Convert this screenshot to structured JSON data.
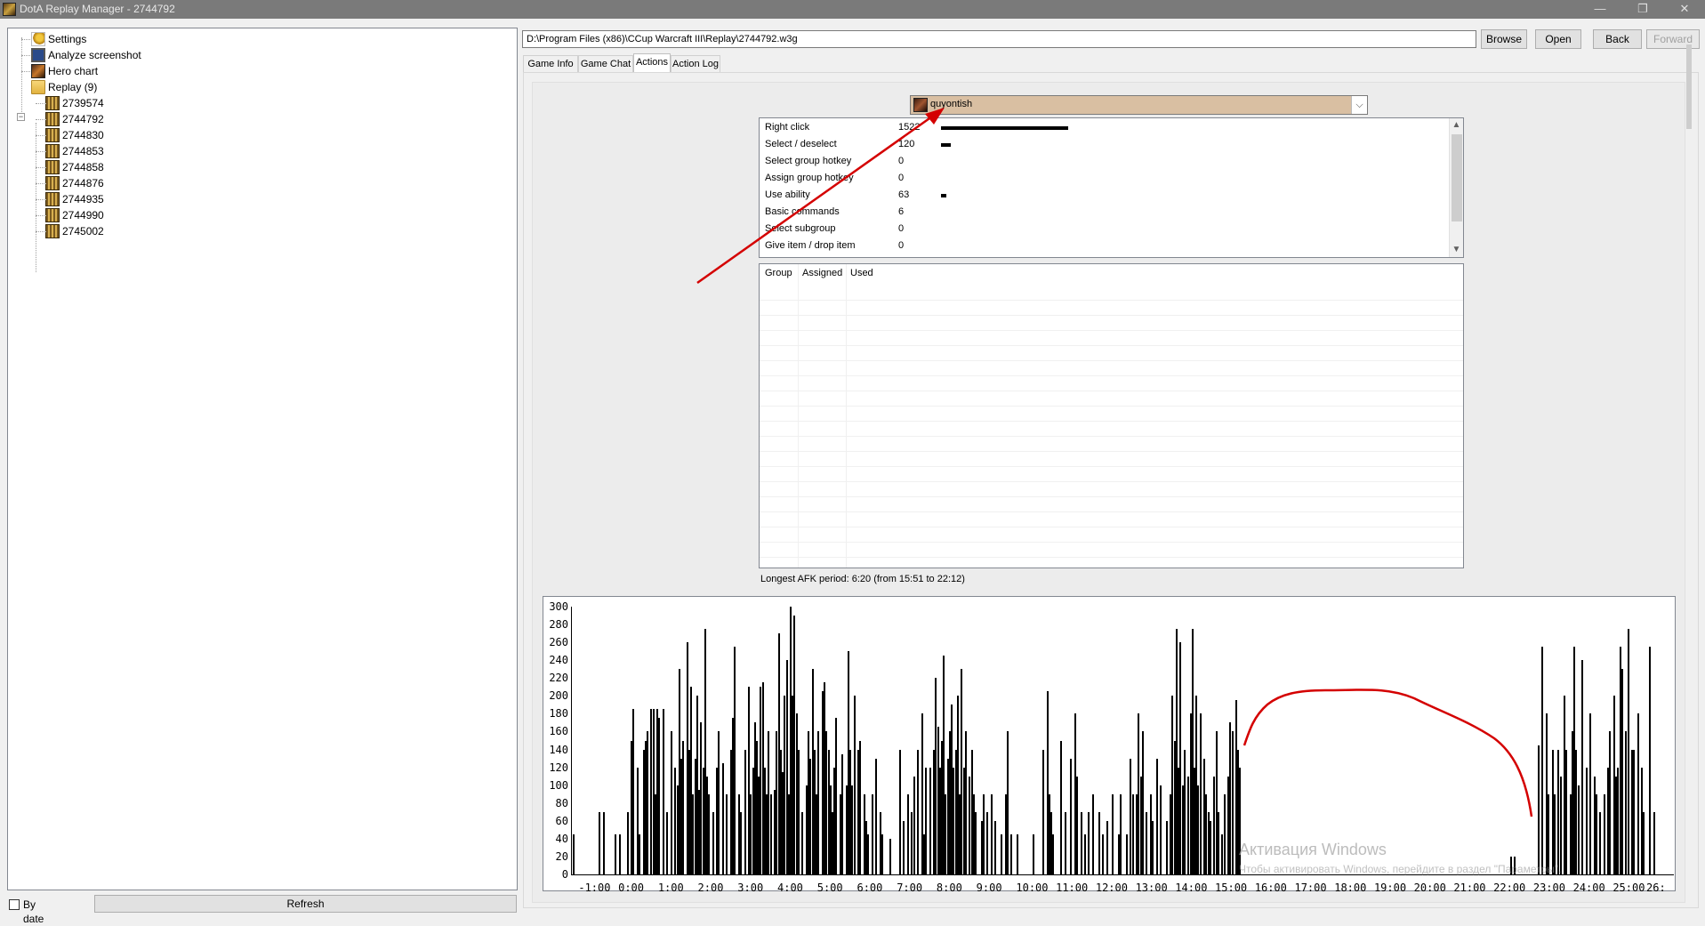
{
  "window": {
    "title": "DotA Replay Manager - 2744792",
    "minimize": "—",
    "maximize": "❐",
    "close": "✕"
  },
  "tree": {
    "settings": "Settings",
    "analyze_screenshot": "Analyze screenshot",
    "hero_chart": "Hero chart",
    "replay_folder": "Replay (9)",
    "replays": [
      "2739574",
      "2744792",
      "2744830",
      "2744853",
      "2744858",
      "2744876",
      "2744935",
      "2744990",
      "2745002"
    ]
  },
  "bydate": "By date",
  "refresh": "Refresh",
  "path": "D:\\Program Files (x86)\\CCup Warcraft III\\Replay\\2744792.w3g",
  "buttons": {
    "browse": "Browse",
    "open": "Open",
    "back": "Back",
    "forward": "Forward"
  },
  "tabs": [
    "Game Info",
    "Game Chat",
    "Actions",
    "Action Log"
  ],
  "player": {
    "name": "quyontish"
  },
  "actions": [
    {
      "name": "Right click",
      "count": "1522",
      "bar": 1522
    },
    {
      "name": "Select / deselect",
      "count": "120",
      "bar": 120
    },
    {
      "name": "Select group hotkey",
      "count": "0",
      "bar": 0
    },
    {
      "name": "Assign group hotkey",
      "count": "0",
      "bar": 0
    },
    {
      "name": "Use ability",
      "count": "63",
      "bar": 63
    },
    {
      "name": "Basic commands",
      "count": "6",
      "bar": 0
    },
    {
      "name": "Select subgroup",
      "count": "0",
      "bar": 0
    },
    {
      "name": "Give item / drop item",
      "count": "0",
      "bar": 0
    }
  ],
  "groups_header": {
    "group": "Group",
    "assigned": "Assigned",
    "used": "Used"
  },
  "afk": "Longest AFK period: 6:20 (from 15:51 to 22:12)",
  "chart_data": {
    "type": "bar",
    "ylim": [
      0,
      300
    ],
    "yticks": [
      "0",
      "20",
      "40",
      "60",
      "80",
      "100",
      "120",
      "140",
      "160",
      "180",
      "200",
      "220",
      "240",
      "260",
      "280",
      "300"
    ],
    "xticks": [
      "-1:00",
      "0:00",
      "1:00",
      "2:00",
      "3:00",
      "4:00",
      "5:00",
      "6:00",
      "7:00",
      "8:00",
      "9:00",
      "10:00",
      "11:00",
      "12:00",
      "13:00",
      "14:00",
      "15:00",
      "16:00",
      "17:00",
      "18:00",
      "19:00",
      "20:00",
      "21:00",
      "22:00",
      "23:00",
      "24:00",
      "25:00",
      "26:"
    ],
    "xlim": [
      -1.5,
      26.2
    ],
    "bars": [
      [
        -1.45,
        45
      ],
      [
        -0.8,
        70
      ],
      [
        -0.7,
        70
      ],
      [
        -0.4,
        45
      ],
      [
        -0.3,
        45
      ],
      [
        -0.1,
        70
      ],
      [
        0.0,
        150
      ],
      [
        0.05,
        185
      ],
      [
        0.15,
        120
      ],
      [
        0.2,
        45
      ],
      [
        0.3,
        140
      ],
      [
        0.35,
        150
      ],
      [
        0.4,
        160
      ],
      [
        0.5,
        185
      ],
      [
        0.55,
        185
      ],
      [
        0.6,
        90
      ],
      [
        0.65,
        185
      ],
      [
        0.7,
        175
      ],
      [
        0.8,
        185
      ],
      [
        0.9,
        70
      ],
      [
        1.0,
        160
      ],
      [
        1.1,
        120
      ],
      [
        1.15,
        100
      ],
      [
        1.2,
        230
      ],
      [
        1.25,
        130
      ],
      [
        1.3,
        150
      ],
      [
        1.4,
        260
      ],
      [
        1.45,
        140
      ],
      [
        1.5,
        210
      ],
      [
        1.55,
        90
      ],
      [
        1.6,
        130
      ],
      [
        1.65,
        200
      ],
      [
        1.7,
        95
      ],
      [
        1.75,
        170
      ],
      [
        1.8,
        120
      ],
      [
        1.85,
        275
      ],
      [
        1.9,
        110
      ],
      [
        1.95,
        90
      ],
      [
        2.05,
        70
      ],
      [
        2.15,
        120
      ],
      [
        2.2,
        160
      ],
      [
        2.3,
        125
      ],
      [
        2.4,
        90
      ],
      [
        2.5,
        140
      ],
      [
        2.55,
        175
      ],
      [
        2.6,
        255
      ],
      [
        2.7,
        90
      ],
      [
        2.75,
        70
      ],
      [
        2.85,
        140
      ],
      [
        2.95,
        210
      ],
      [
        3.0,
        90
      ],
      [
        3.05,
        120
      ],
      [
        3.1,
        170
      ],
      [
        3.15,
        150
      ],
      [
        3.2,
        110
      ],
      [
        3.25,
        210
      ],
      [
        3.3,
        215
      ],
      [
        3.35,
        120
      ],
      [
        3.4,
        90
      ],
      [
        3.45,
        160
      ],
      [
        3.5,
        90
      ],
      [
        3.6,
        95
      ],
      [
        3.65,
        160
      ],
      [
        3.7,
        270
      ],
      [
        3.75,
        140
      ],
      [
        3.8,
        115
      ],
      [
        3.85,
        200
      ],
      [
        3.9,
        240
      ],
      [
        3.95,
        90
      ],
      [
        4.0,
        300
      ],
      [
        4.05,
        200
      ],
      [
        4.1,
        290
      ],
      [
        4.15,
        180
      ],
      [
        4.2,
        140
      ],
      [
        4.3,
        70
      ],
      [
        4.4,
        100
      ],
      [
        4.45,
        160
      ],
      [
        4.5,
        130
      ],
      [
        4.55,
        230
      ],
      [
        4.6,
        140
      ],
      [
        4.65,
        90
      ],
      [
        4.7,
        160
      ],
      [
        4.8,
        205
      ],
      [
        4.85,
        215
      ],
      [
        4.9,
        160
      ],
      [
        4.95,
        140
      ],
      [
        5.0,
        100
      ],
      [
        5.05,
        70
      ],
      [
        5.1,
        120
      ],
      [
        5.15,
        175
      ],
      [
        5.25,
        90
      ],
      [
        5.3,
        135
      ],
      [
        5.4,
        100
      ],
      [
        5.45,
        250
      ],
      [
        5.5,
        140
      ],
      [
        5.55,
        100
      ],
      [
        5.6,
        200
      ],
      [
        5.7,
        140
      ],
      [
        5.75,
        150
      ],
      [
        5.85,
        90
      ],
      [
        5.9,
        60
      ],
      [
        5.95,
        45
      ],
      [
        6.05,
        90
      ],
      [
        6.15,
        130
      ],
      [
        6.25,
        70
      ],
      [
        6.3,
        45
      ],
      [
        6.5,
        40
      ],
      [
        6.75,
        140
      ],
      [
        6.85,
        60
      ],
      [
        6.95,
        90
      ],
      [
        7.05,
        70
      ],
      [
        7.1,
        110
      ],
      [
        7.2,
        140
      ],
      [
        7.3,
        180
      ],
      [
        7.35,
        45
      ],
      [
        7.4,
        120
      ],
      [
        7.5,
        120
      ],
      [
        7.6,
        140
      ],
      [
        7.65,
        220
      ],
      [
        7.7,
        165
      ],
      [
        7.75,
        120
      ],
      [
        7.8,
        150
      ],
      [
        7.85,
        245
      ],
      [
        7.9,
        90
      ],
      [
        7.95,
        130
      ],
      [
        8.0,
        160
      ],
      [
        8.05,
        190
      ],
      [
        8.1,
        120
      ],
      [
        8.15,
        140
      ],
      [
        8.2,
        200
      ],
      [
        8.25,
        90
      ],
      [
        8.3,
        230
      ],
      [
        8.35,
        120
      ],
      [
        8.4,
        160
      ],
      [
        8.5,
        110
      ],
      [
        8.55,
        140
      ],
      [
        8.6,
        90
      ],
      [
        8.65,
        70
      ],
      [
        8.8,
        60
      ],
      [
        8.85,
        90
      ],
      [
        8.95,
        70
      ],
      [
        9.05,
        90
      ],
      [
        9.15,
        60
      ],
      [
        9.3,
        45
      ],
      [
        9.4,
        90
      ],
      [
        9.45,
        160
      ],
      [
        9.55,
        45
      ],
      [
        9.7,
        45
      ],
      [
        10.1,
        45
      ],
      [
        10.35,
        140
      ],
      [
        10.45,
        205
      ],
      [
        10.5,
        90
      ],
      [
        10.55,
        70
      ],
      [
        10.6,
        45
      ],
      [
        10.8,
        150
      ],
      [
        10.9,
        70
      ],
      [
        11.05,
        130
      ],
      [
        11.15,
        180
      ],
      [
        11.2,
        110
      ],
      [
        11.3,
        70
      ],
      [
        11.4,
        45
      ],
      [
        11.5,
        70
      ],
      [
        11.6,
        90
      ],
      [
        11.75,
        70
      ],
      [
        11.85,
        45
      ],
      [
        11.95,
        60
      ],
      [
        12.1,
        90
      ],
      [
        12.25,
        45
      ],
      [
        12.3,
        90
      ],
      [
        12.45,
        45
      ],
      [
        12.55,
        130
      ],
      [
        12.6,
        90
      ],
      [
        12.7,
        90
      ],
      [
        12.75,
        180
      ],
      [
        12.8,
        110
      ],
      [
        12.85,
        160
      ],
      [
        12.95,
        70
      ],
      [
        13.05,
        90
      ],
      [
        13.1,
        60
      ],
      [
        13.2,
        130
      ],
      [
        13.3,
        100
      ],
      [
        13.45,
        60
      ],
      [
        13.55,
        90
      ],
      [
        13.6,
        200
      ],
      [
        13.65,
        150
      ],
      [
        13.7,
        275
      ],
      [
        13.75,
        120
      ],
      [
        13.8,
        260
      ],
      [
        13.85,
        100
      ],
      [
        13.9,
        140
      ],
      [
        14.0,
        110
      ],
      [
        14.05,
        180
      ],
      [
        14.1,
        275
      ],
      [
        14.15,
        120
      ],
      [
        14.2,
        200
      ],
      [
        14.25,
        100
      ],
      [
        14.3,
        180
      ],
      [
        14.4,
        130
      ],
      [
        14.45,
        90
      ],
      [
        14.5,
        70
      ],
      [
        14.55,
        60
      ],
      [
        14.65,
        110
      ],
      [
        14.7,
        160
      ],
      [
        14.75,
        70
      ],
      [
        14.85,
        45
      ],
      [
        14.9,
        90
      ],
      [
        15.0,
        110
      ],
      [
        15.05,
        170
      ],
      [
        15.1,
        160
      ],
      [
        15.2,
        195
      ],
      [
        15.25,
        140
      ],
      [
        15.3,
        120
      ],
      [
        22.1,
        20
      ],
      [
        22.2,
        20
      ],
      [
        22.8,
        145
      ],
      [
        22.9,
        255
      ],
      [
        23.0,
        180
      ],
      [
        23.05,
        90
      ],
      [
        23.15,
        140
      ],
      [
        23.2,
        90
      ],
      [
        23.3,
        140
      ],
      [
        23.35,
        110
      ],
      [
        23.45,
        200
      ],
      [
        23.5,
        140
      ],
      [
        23.6,
        90
      ],
      [
        23.65,
        160
      ],
      [
        23.7,
        255
      ],
      [
        23.75,
        140
      ],
      [
        23.8,
        100
      ],
      [
        23.9,
        240
      ],
      [
        24.0,
        120
      ],
      [
        24.1,
        180
      ],
      [
        24.2,
        110
      ],
      [
        24.25,
        90
      ],
      [
        24.35,
        70
      ],
      [
        24.45,
        90
      ],
      [
        24.55,
        120
      ],
      [
        24.6,
        160
      ],
      [
        24.7,
        200
      ],
      [
        24.75,
        110
      ],
      [
        24.8,
        120
      ],
      [
        24.85,
        255
      ],
      [
        24.9,
        230
      ],
      [
        25.0,
        160
      ],
      [
        25.05,
        275
      ],
      [
        25.15,
        140
      ],
      [
        25.2,
        140
      ],
      [
        25.3,
        180
      ],
      [
        25.4,
        120
      ],
      [
        25.45,
        70
      ],
      [
        25.6,
        255
      ],
      [
        25.7,
        70
      ]
    ]
  },
  "watermark": {
    "line1": "Активация Windows",
    "line2": "Чтобы активировать Windows, перейдите в раздел \"Параметры\"."
  },
  "colors": {
    "annotation": "#d40000",
    "player_bg": "#d9bfa2",
    "titlebar": "#7a7a7a"
  }
}
